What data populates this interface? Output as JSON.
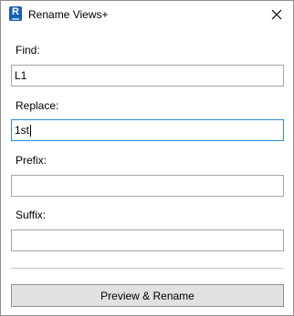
{
  "window": {
    "title": "Rename Views+",
    "app_icon": "revit-r-icon",
    "close_icon": "close-icon"
  },
  "form": {
    "find": {
      "label": "Find:",
      "value": "L1",
      "placeholder": ""
    },
    "replace": {
      "label": "Replace:",
      "value": "1st",
      "placeholder": ""
    },
    "prefix": {
      "label": "Prefix:",
      "value": "",
      "placeholder": ""
    },
    "suffix": {
      "label": "Suffix:",
      "value": "",
      "placeholder": ""
    }
  },
  "actions": {
    "preview_rename_label": "Preview & Rename"
  },
  "colors": {
    "focus_border": "#2e8bd8",
    "button_bg": "#e1e1e1",
    "icon_blue": "#1a5fb4"
  }
}
